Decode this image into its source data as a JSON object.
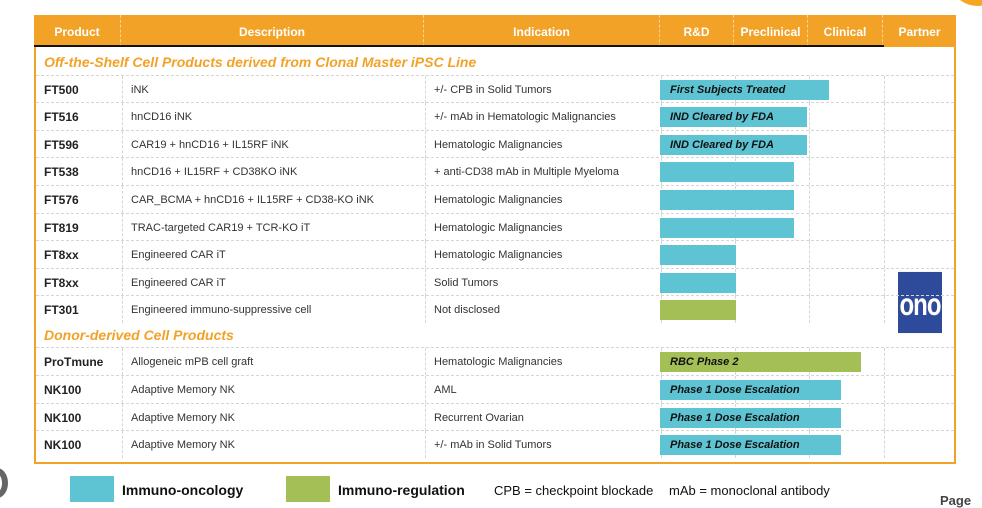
{
  "colors": {
    "header": "#F2A227",
    "immuno_oncology": "#5EC4D3",
    "immuno_regulation": "#A5BF57",
    "partner_logo": "#2E4A9B"
  },
  "header": {
    "product": "Product",
    "description": "Description",
    "indication": "Indication",
    "rd": "R&D",
    "preclinical": "Preclinical",
    "clinical": "Clinical",
    "partner": "Partner"
  },
  "sections": [
    {
      "title": "Off-the-Shelf Cell Products derived from Clonal Master iPSC Line",
      "rows": [
        {
          "product": "FT500",
          "description": "iNK",
          "indication": "+/- CPB in Solid Tumors",
          "category": "immuno_oncology",
          "progress": 0.76,
          "status": "First Subjects Treated"
        },
        {
          "product": "FT516",
          "description": "hnCD16 iNK",
          "indication": "+/- mAb in Hematologic Malignancies",
          "category": "immuno_oncology",
          "progress": 0.66,
          "status": "IND Cleared by FDA"
        },
        {
          "product": "FT596",
          "description": "CAR19 + hnCD16 + IL15RF iNK",
          "indication": "Hematologic Malignancies",
          "category": "immuno_oncology",
          "progress": 0.66,
          "status": "IND Cleared by FDA"
        },
        {
          "product": "FT538",
          "description": "hnCD16 + IL15RF + CD38KO iNK",
          "indication": "+ anti-CD38 mAb in Multiple Myeloma",
          "category": "immuno_oncology",
          "progress": 0.6,
          "status": ""
        },
        {
          "product": "FT576",
          "description": "CAR_BCMA + hnCD16 + IL15RF + CD38-KO iNK",
          "indication": "Hematologic Malignancies",
          "category": "immuno_oncology",
          "progress": 0.6,
          "status": ""
        },
        {
          "product": "FT819",
          "description": "TRAC-targeted CAR19 + TCR-KO iT",
          "indication": "Hematologic Malignancies",
          "category": "immuno_oncology",
          "progress": 0.6,
          "status": ""
        },
        {
          "product": "FT8xx",
          "description": "Engineered CAR iT",
          "indication": "Hematologic Malignancies",
          "category": "immuno_oncology",
          "progress": 0.34,
          "status": ""
        },
        {
          "product": "FT8xx",
          "description": "Engineered CAR iT",
          "indication": "Solid Tumors",
          "category": "immuno_oncology",
          "progress": 0.34,
          "status": ""
        },
        {
          "product": "FT301",
          "description": "Engineered immuno-suppressive cell",
          "indication": "Not disclosed",
          "category": "immuno_regulation",
          "progress": 0.34,
          "status": ""
        }
      ]
    },
    {
      "title": "Donor-derived Cell Products",
      "rows": [
        {
          "product": "ProTmune",
          "description": "Allogeneic mPB cell graft",
          "indication": "Hematologic Malignancies",
          "category": "immuno_regulation",
          "progress": 0.9,
          "status": "RBC Phase 2"
        },
        {
          "product": "NK100",
          "description": "Adaptive Memory NK",
          "indication": "AML",
          "category": "immuno_oncology",
          "progress": 0.81,
          "status": "Phase 1 Dose Escalation"
        },
        {
          "product": "NK100",
          "description": "Adaptive Memory NK",
          "indication": "Recurrent Ovarian",
          "category": "immuno_oncology",
          "progress": 0.81,
          "status": "Phase 1 Dose Escalation"
        },
        {
          "product": "NK100",
          "description": "Adaptive Memory NK",
          "indication": "+/- mAb in Solid Tumors",
          "category": "immuno_oncology",
          "progress": 0.81,
          "status": "Phase 1 Dose Escalation"
        }
      ]
    }
  ],
  "partner": {
    "logo_text": "ono",
    "rows": "FT8xx"
  },
  "legend": {
    "immuno_oncology": "Immuno-oncology",
    "immuno_regulation": "Immuno-regulation",
    "cpb": "CPB = checkpoint blockade",
    "mab": "mAb = monoclonal antibody"
  },
  "footer": {
    "page": "Page"
  }
}
